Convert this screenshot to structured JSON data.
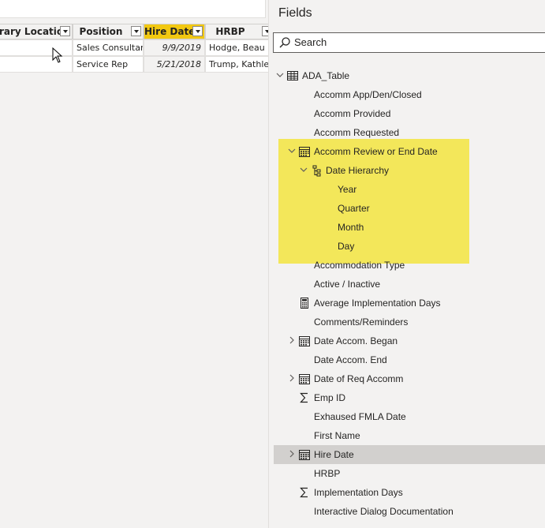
{
  "table": {
    "columns": [
      {
        "label": "rary Location",
        "selected": false
      },
      {
        "label": "Position",
        "selected": false
      },
      {
        "label": "Hire Date",
        "selected": true
      },
      {
        "label": "HRBP",
        "selected": false
      }
    ],
    "rows": [
      {
        "position": "Sales Consultant",
        "hire_date": "9/9/2019",
        "hrbp": "Hodge, Beau"
      },
      {
        "position": "Service Rep",
        "hire_date": "5/21/2018",
        "hrbp": "Trump, Kathleen"
      }
    ],
    "selected_color": "#f2c811"
  },
  "fields_pane": {
    "title": "Fields",
    "search_placeholder": "Search",
    "table_name": "ADA_Table",
    "highlight_color": "#f3e75a",
    "fields": [
      {
        "label": "Accomm App/Den/Closed",
        "icon": "none"
      },
      {
        "label": "Accomm Provided",
        "icon": "none"
      },
      {
        "label": "Accomm Requested",
        "icon": "none"
      },
      {
        "label": "Accomm Review or End Date",
        "icon": "calendar-icon",
        "expanded": true
      },
      {
        "label": "Date Hierarchy",
        "icon": "hierarchy-icon",
        "expanded": true,
        "level": 1
      },
      {
        "label": "Year",
        "icon": "none",
        "level": 2
      },
      {
        "label": "Quarter",
        "icon": "none",
        "level": 2
      },
      {
        "label": "Month",
        "icon": "none",
        "level": 2
      },
      {
        "label": "Day",
        "icon": "none",
        "level": 2
      },
      {
        "label": "Accommodation Type",
        "icon": "none"
      },
      {
        "label": "Active / Inactive",
        "icon": "none"
      },
      {
        "label": "Average Implementation Days",
        "icon": "calculator-icon"
      },
      {
        "label": "Comments/Reminders",
        "icon": "none"
      },
      {
        "label": "Date Accom. Began",
        "icon": "calendar-icon",
        "expanded": false
      },
      {
        "label": "Date Accom. End",
        "icon": "none"
      },
      {
        "label": "Date of Req Accomm",
        "icon": "calendar-icon",
        "expanded": false
      },
      {
        "label": "Emp ID",
        "icon": "sigma-icon"
      },
      {
        "label": "Exhaused FMLA Date",
        "icon": "none"
      },
      {
        "label": "First Name",
        "icon": "none"
      },
      {
        "label": "Hire Date",
        "icon": "calendar-icon",
        "expanded": false,
        "selected": true
      },
      {
        "label": "HRBP",
        "icon": "none"
      },
      {
        "label": "Implementation Days",
        "icon": "sigma-icon"
      },
      {
        "label": "Interactive Dialog Documentation",
        "icon": "none"
      }
    ]
  }
}
